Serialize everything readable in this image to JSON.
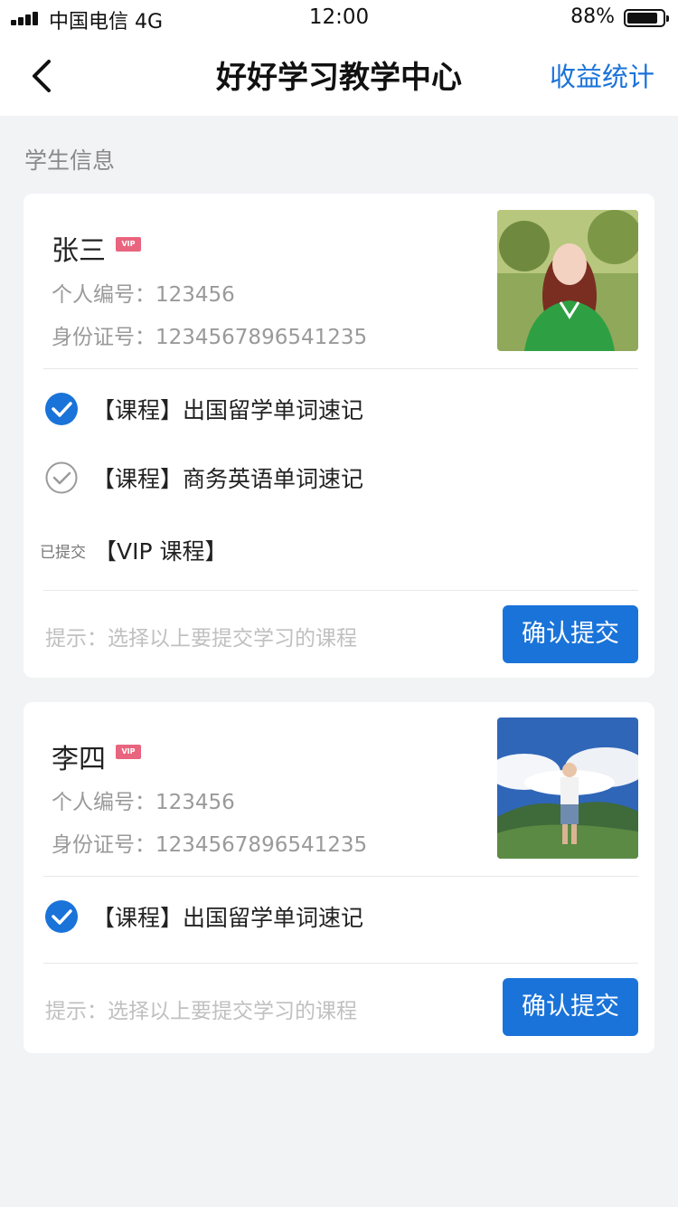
{
  "status_bar": {
    "carrier": "中国电信  4G",
    "time": "12:00",
    "battery_pct": "88%",
    "battery_level": 0.88
  },
  "nav": {
    "title": "好好学习教学中心",
    "right_action": "收益统计",
    "back_icon": "chevron-left-icon"
  },
  "section": {
    "title": "学生信息"
  },
  "students": [
    {
      "name": "张三",
      "badge": "VIP",
      "id_label": "个人编号：",
      "id_value": "123456",
      "idcard_label": "身份证号：",
      "idcard_value": "1234567896541235",
      "courses": [
        {
          "text": "【课程】出国留学单词速记",
          "checked": true
        },
        {
          "text": "【课程】商务英语单词速记",
          "checked": false
        }
      ],
      "submitted_tag": "已提交",
      "submitted_course": "【VIP 课程】",
      "hint": "提示：选择以上要提交学习的课程",
      "confirm": "确认提交"
    },
    {
      "name": "李四",
      "badge": "VIP",
      "id_label": "个人编号：",
      "id_value": "123456",
      "idcard_label": "身份证号：",
      "idcard_value": "1234567896541235",
      "courses": [
        {
          "text": "【课程】出国留学单词速记",
          "checked": true
        }
      ],
      "hint": "提示：选择以上要提交学习的课程",
      "confirm": "确认提交"
    }
  ],
  "colors": {
    "accent": "#1a73d9",
    "background": "#f2f3f5",
    "vip": "#e9647e"
  }
}
